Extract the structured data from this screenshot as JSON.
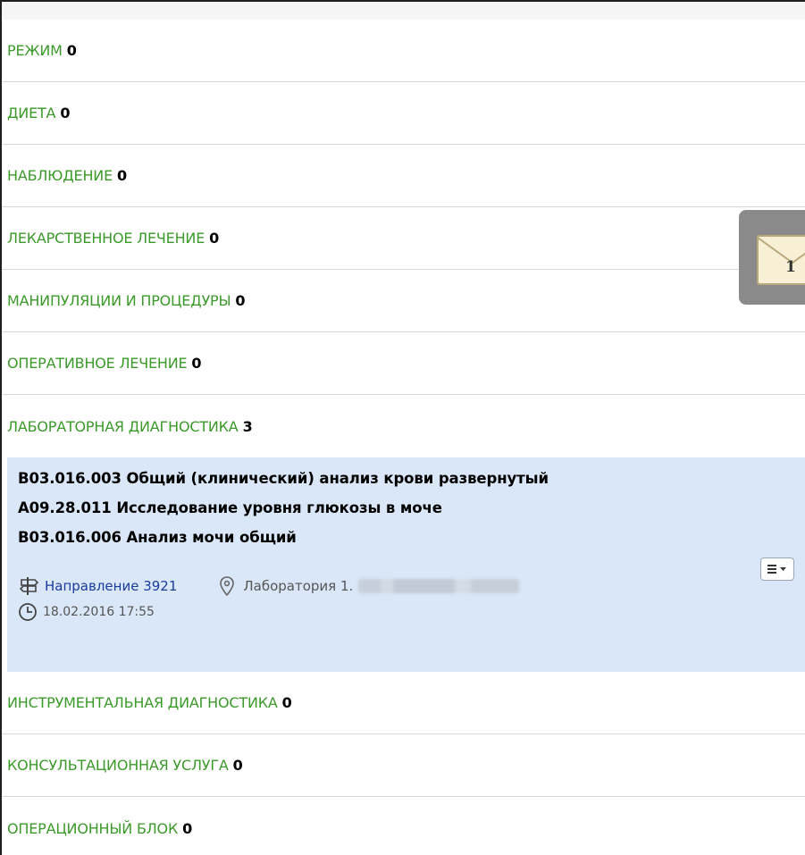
{
  "sections_before": [
    {
      "label": "РЕЖИМ",
      "count": "0"
    },
    {
      "label": "ДИЕТА",
      "count": "0"
    },
    {
      "label": "НАБЛЮДЕНИЕ",
      "count": "0"
    },
    {
      "label": "ЛЕКАРСТВЕННОЕ ЛЕЧЕНИЕ",
      "count": "0"
    },
    {
      "label": "МАНИПУЛЯЦИИ И ПРОЦЕДУРЫ",
      "count": "0"
    },
    {
      "label": "ОПЕРАТИВНОЕ ЛЕЧЕНИЕ",
      "count": "0"
    },
    {
      "label": "ЛАБОРАТОРНАЯ ДИАГНОСТИКА",
      "count": "3"
    }
  ],
  "lab_details": {
    "services": [
      "B03.016.003 Общий (клинический) анализ крови развернутый",
      "A09.28.011 Исследование уровня глюкозы в моче",
      "B03.016.006 Анализ мочи общий"
    ],
    "direction_link": "Направление 3921",
    "laboratory": "Лаборатория 1.",
    "datetime": "18.02.2016 17:55"
  },
  "sections_after": [
    {
      "label": "ИНСТРУМЕНТАЛЬНАЯ ДИАГНОСТИКА",
      "count": "0"
    },
    {
      "label": "КОНСУЛЬТАЦИОННАЯ УСЛУГА",
      "count": "0"
    },
    {
      "label": "ОПЕРАЦИОННЫЙ БЛОК",
      "count": "0"
    }
  ],
  "notification": {
    "count": "1"
  },
  "colors": {
    "section_label": "#3b9a2a",
    "details_bg": "#dae7f8",
    "link": "#1a3c9c"
  }
}
